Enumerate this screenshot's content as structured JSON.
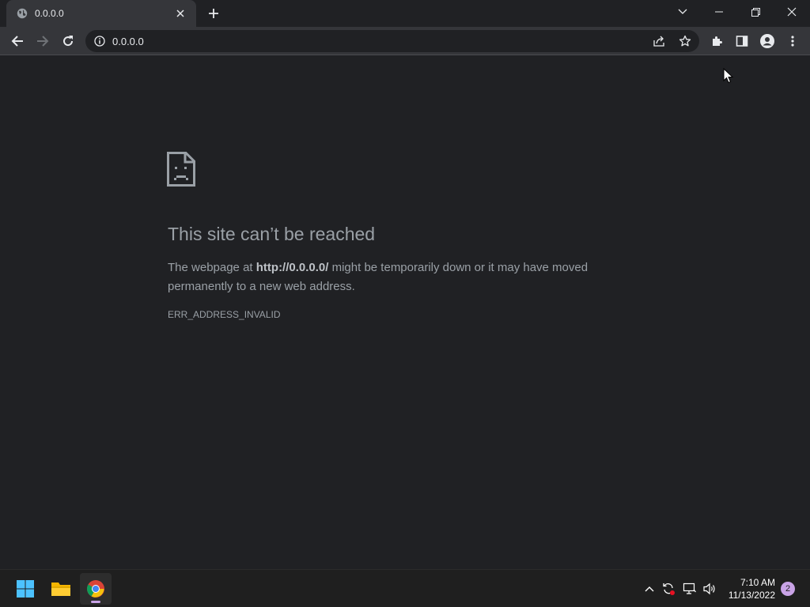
{
  "tab": {
    "title": "0.0.0.0",
    "favicon": "globe-icon"
  },
  "toolbar": {
    "url": "0.0.0.0"
  },
  "error": {
    "heading": "This site can’t be reached",
    "body_prefix": "The webpage at ",
    "body_url": "http://0.0.0.0/",
    "body_suffix": " might be temporarily down or it may have moved permanently to a new web address.",
    "code": "ERR_ADDRESS_INVALID"
  },
  "taskbar": {
    "pinned": [
      "start-icon",
      "file-explorer-icon",
      "chrome-icon"
    ],
    "clock_time": "7:10 AM",
    "clock_date": "11/13/2022",
    "notification_count": "2"
  },
  "colors": {
    "page_background": "#202124",
    "toolbar_background": "#35363a",
    "text_secondary": "#9aa0a6",
    "accent_purple": "#c9a3e6"
  }
}
